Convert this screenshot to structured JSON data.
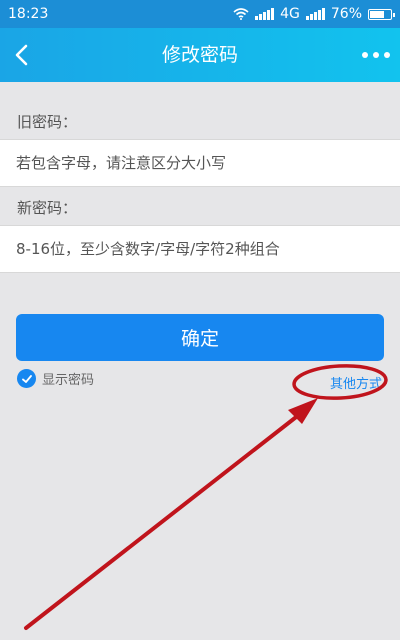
{
  "status": {
    "time": "18:23",
    "network": "4G",
    "battery": "76%",
    "battery_level": 0.76
  },
  "appbar": {
    "title": "修改密码"
  },
  "form": {
    "old_label": "旧密码：",
    "old_placeholder": "若包含字母，请注意区分大小写",
    "new_label": "新密码：",
    "new_placeholder": "8-16位，至少含数字/字母/字符2种组合"
  },
  "actions": {
    "confirm_label": "确定",
    "show_password_label": "显示密码",
    "other_methods_label": "其他方式"
  },
  "colors": {
    "accent": "#1787f0",
    "appbar": "#12c3ee",
    "annotation": "#c0141c"
  }
}
